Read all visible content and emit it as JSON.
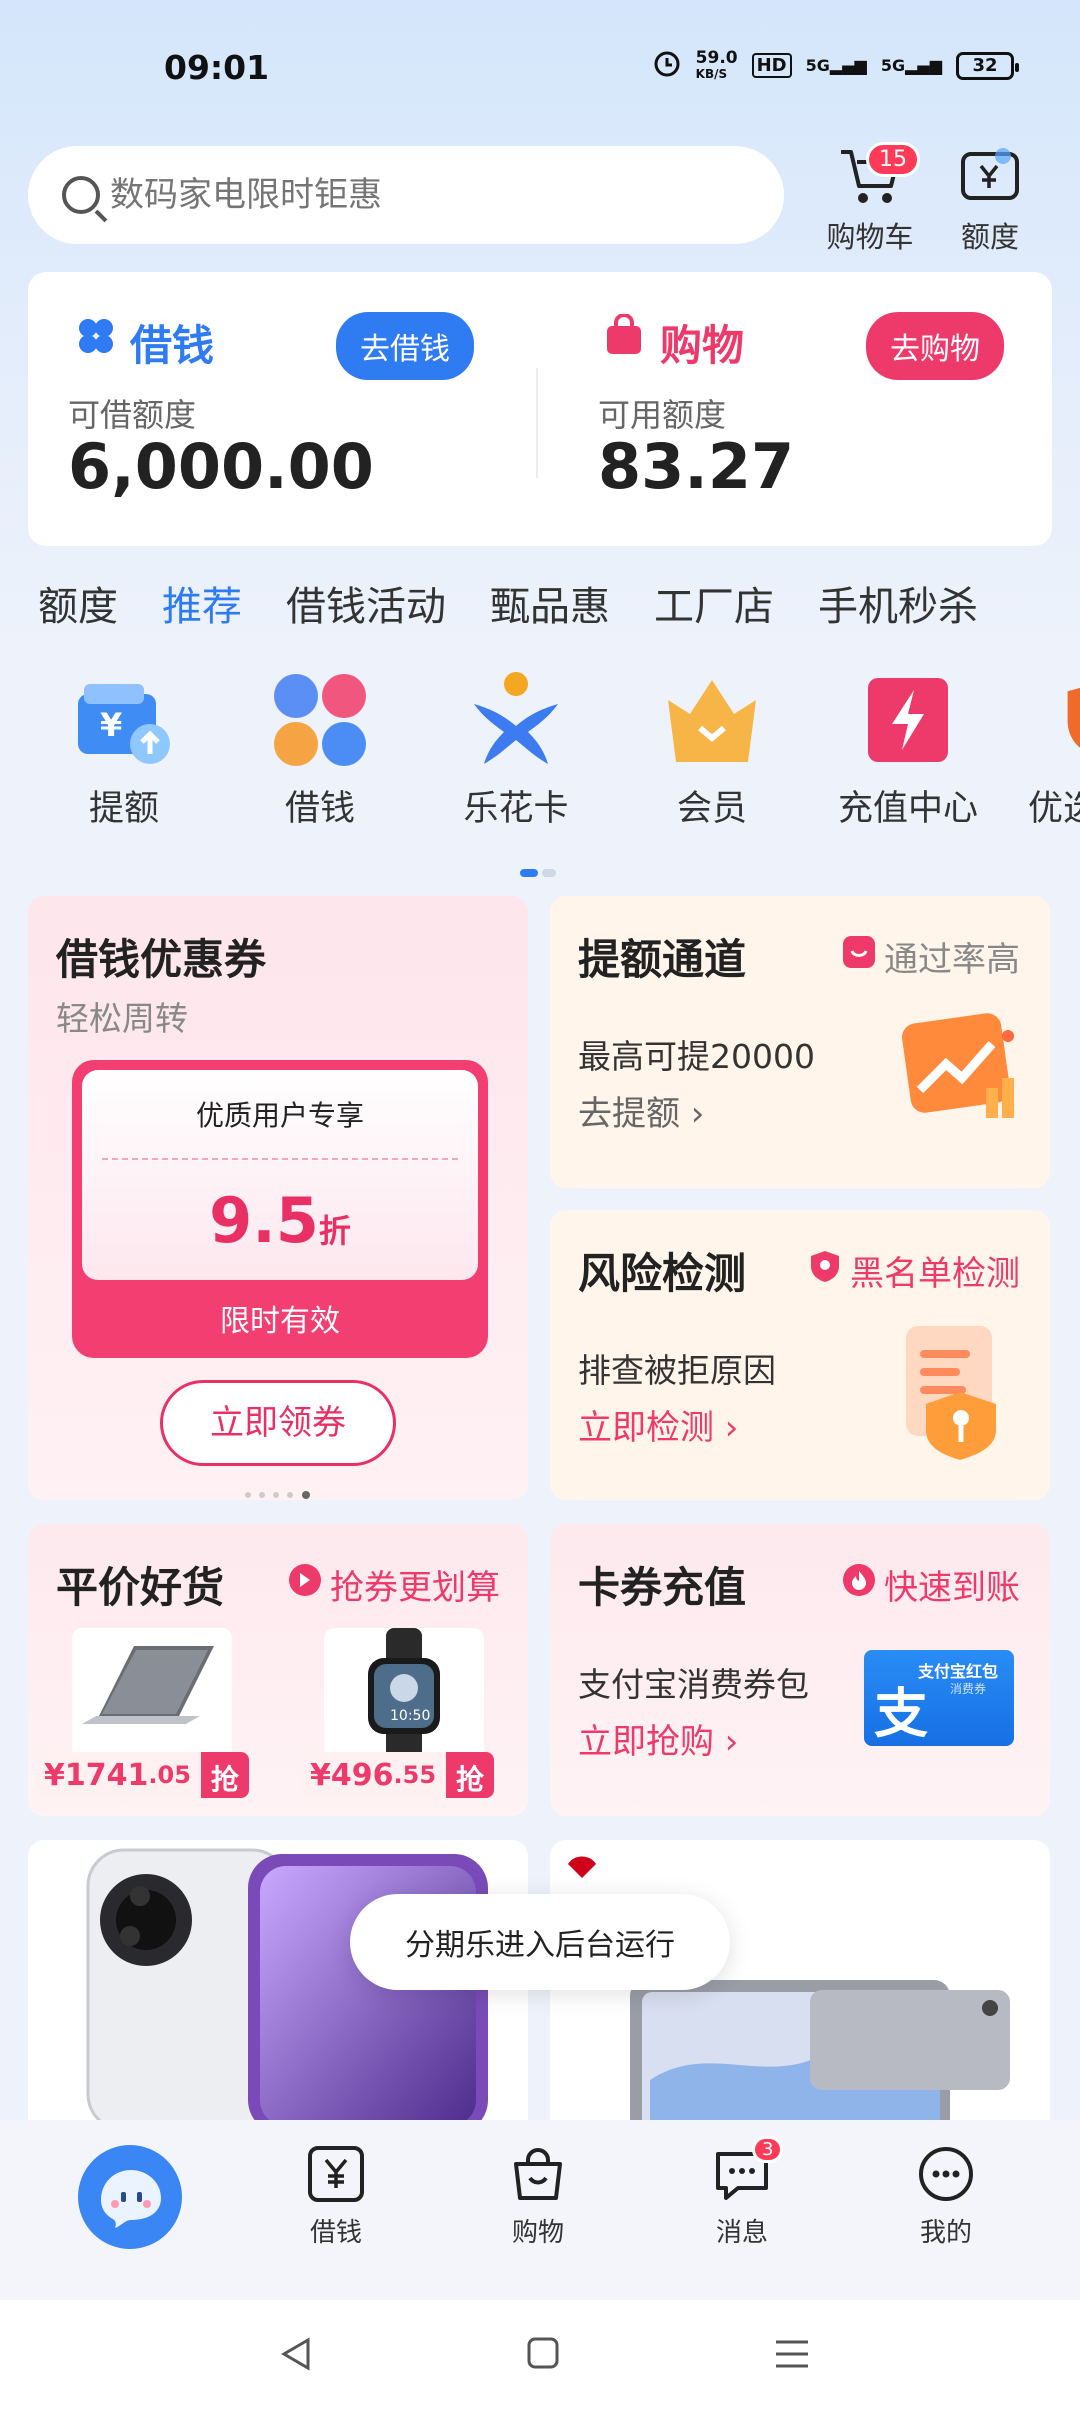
{
  "status_bar": {
    "time": "09:01",
    "speed": "59.0",
    "speed_unit": "KB/S",
    "hd": "HD",
    "net1": "5G",
    "net2": "5G",
    "battery": "32"
  },
  "search": {
    "placeholder": "数码家电限时钜惠"
  },
  "header_buttons": {
    "cart_label": "购物车",
    "cart_badge": "15",
    "quota_label": "额度"
  },
  "summary": {
    "borrow": {
      "title": "借钱",
      "button": "去借钱",
      "label": "可借额度",
      "value": "6,000.00"
    },
    "shop": {
      "title": "购物",
      "button": "去购物",
      "label": "可用额度",
      "value": "83.27"
    }
  },
  "tabs": [
    {
      "label": "额度"
    },
    {
      "label": "推荐"
    },
    {
      "label": "借钱活动"
    },
    {
      "label": "甄品惠"
    },
    {
      "label": "工厂店"
    },
    {
      "label": "手机秒杀"
    }
  ],
  "quick_icons": [
    {
      "label": "提额",
      "icon": "wallet-up-icon"
    },
    {
      "label": "借钱",
      "icon": "four-petal-icon"
    },
    {
      "label": "乐花卡",
      "icon": "star-person-icon"
    },
    {
      "label": "会员",
      "icon": "crown-icon"
    },
    {
      "label": "充值中心",
      "icon": "lightning-icon"
    },
    {
      "label": "优选",
      "icon": "shield-icon"
    }
  ],
  "coupon_card": {
    "title": "借钱优惠券",
    "subtitle": "轻松周转",
    "ticket_header": "优质用户专享",
    "discount": "9.5",
    "discount_unit": "折",
    "ticket_footer": "限时有效",
    "button": "立即领券"
  },
  "limit_card": {
    "title": "提额通道",
    "tag": "通过率高",
    "line1": "最高可提20000",
    "link": "去提额"
  },
  "risk_card": {
    "title": "风险检测",
    "tag": "黑名单检测",
    "line1": "排查被拒原因",
    "link": "立即检测"
  },
  "goods_card": {
    "title": "平价好货",
    "tag": "抢券更划算",
    "products": [
      {
        "price_int": "¥1741",
        "price_dec": ".05",
        "grab": "抢",
        "image": "laptop-image"
      },
      {
        "price_int": "¥496",
        "price_dec": ".55",
        "grab": "抢",
        "image": "smartwatch-image"
      }
    ]
  },
  "recharge_card": {
    "title": "卡券充值",
    "tag": "快速到账",
    "line1": "支付宝消费券包",
    "link": "立即抢购",
    "alipay_title": "支付宝红包",
    "alipay_sub": "消费券"
  },
  "toast": {
    "text": "分期乐进入后台运行"
  },
  "bottom_nav": [
    {
      "label": "",
      "icon": "mascot-icon"
    },
    {
      "label": "借钱",
      "icon": "yen-box-icon"
    },
    {
      "label": "购物",
      "icon": "bag-icon"
    },
    {
      "label": "消息",
      "icon": "chat-icon",
      "badge": "3"
    },
    {
      "label": "我的",
      "icon": "more-circle-icon"
    }
  ],
  "colors": {
    "blue": "#2f7bf2",
    "pink": "#ee3a6a",
    "accent_red": "#ff3b57"
  }
}
